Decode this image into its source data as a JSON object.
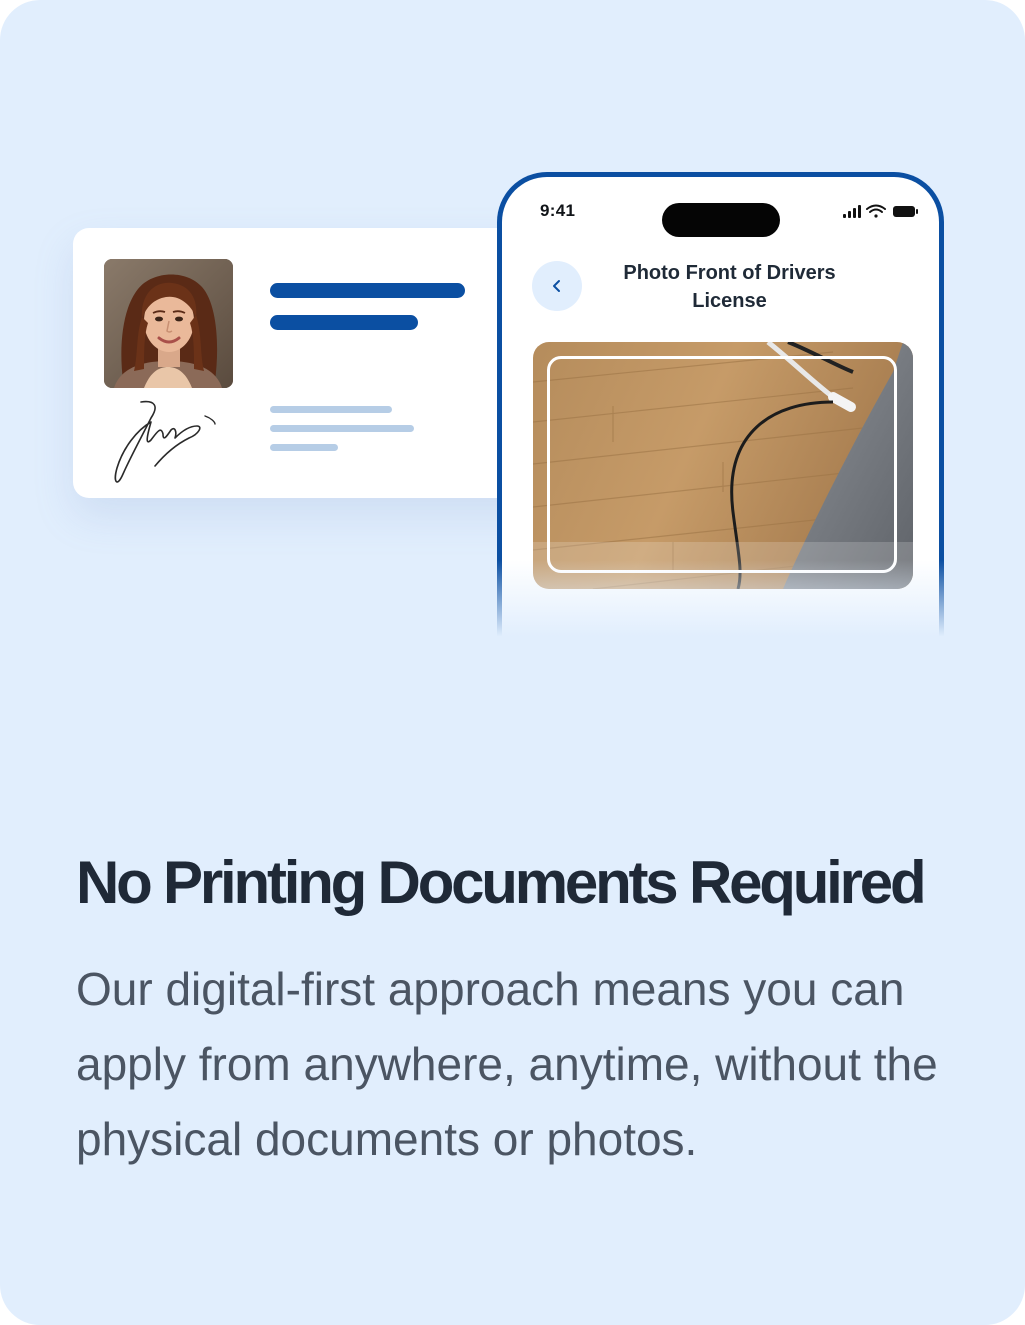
{
  "phone": {
    "status_time": "9:41",
    "screen_title": "Photo Front of Drivers License",
    "back_icon": "chevron-left-icon"
  },
  "id_card": {
    "photo": "portrait-photo",
    "signature": "handwritten-signature"
  },
  "content": {
    "headline": "No Printing Documents Required",
    "body": "Our digital-first approach means you can apply from anywhere, anytime, without the physical documents or photos."
  },
  "colors": {
    "background": "#e1eefd",
    "accent": "#0b4fa2",
    "headline": "#1f2937",
    "body": "#4b5563"
  }
}
